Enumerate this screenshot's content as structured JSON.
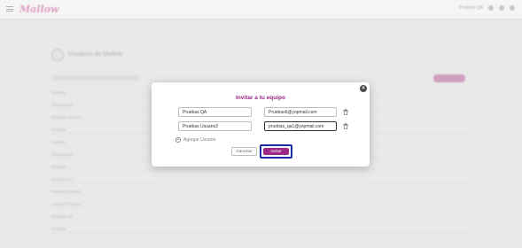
{
  "app": {
    "logo_text": "Mallow",
    "top_right_text": "Pruebas QA"
  },
  "background": {
    "page_title": "Usuarios de Mallow",
    "rows": [
      "Nombre",
      "Pruebas QA",
      "Pruebas Usuario",
      "Pruebas",
      "Usuario",
      "Pruebas QA",
      "Pruebas",
      "Usuario QA",
      "Pruebas Usuario",
      "Usuario Pruebas",
      "Pruebas QA",
      "Pruebas"
    ]
  },
  "modal": {
    "title": "Invitar a tu equipo",
    "rows": [
      {
        "name": "Pruebas QA",
        "email": "Pruebas6@yopmail.com"
      },
      {
        "name": "Pruebas Usuario2",
        "email": "pruebas_qa1@yopmail.com"
      }
    ],
    "add_user_label": "Agregar Usuario",
    "cancel_label": "Cancelar",
    "invite_label": "Invitar",
    "colors": {
      "accent": "#9c2784",
      "focus_ring": "#1f2aa8"
    }
  }
}
